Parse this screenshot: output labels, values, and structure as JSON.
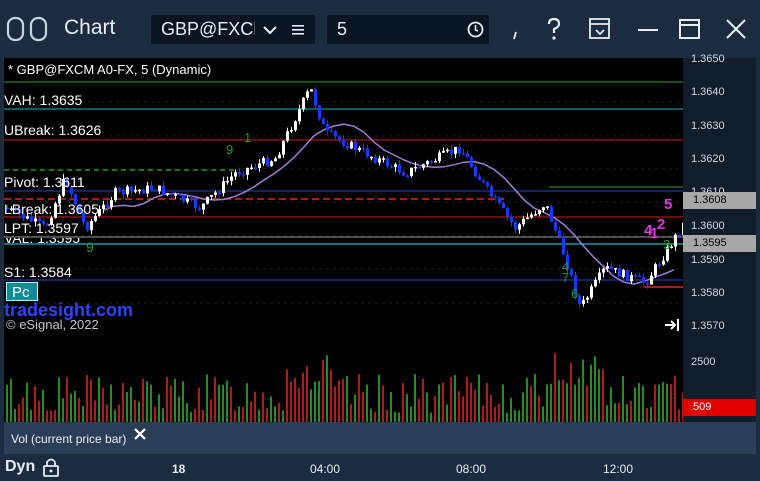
{
  "window": {
    "title": "Chart",
    "symbol_value": "GBP@FXCM",
    "interval_value": "5"
  },
  "chart": {
    "header": "* GBP@FXCM A0-FX, 5 (Dynamic)",
    "level_labels": {
      "vah": "VAH: 1.3635",
      "ubreak": "UBreak: 1.3626",
      "pivot": "Pivot: 1.3611",
      "lbreak": "LBreak: 1.3605",
      "lpt": "LPT: 1.3597",
      "val": "VAL: 1.3595",
      "s1": "S1: 1.3584"
    },
    "partial_badge": "Pc",
    "watermark": "tradesight.com",
    "copyright": "© eSignal, 2022",
    "price_ticks": [
      "1.3650",
      "1.3640",
      "1.3630",
      "1.3620",
      "1.3610",
      "1.3600",
      "1.3590",
      "1.3580",
      "1.3570"
    ],
    "current_price": "1.3608",
    "val_price": "1.3595",
    "counts": [
      "9",
      "4",
      "5",
      "1",
      "2",
      "3",
      "4",
      "7",
      "6",
      "1",
      "9"
    ],
    "colors": {
      "up": "#ffffff",
      "down": "#1638ff",
      "average": "#a07cd8",
      "resistance": "#d21a1a",
      "support_cyan": "#18b5c8",
      "green": "#22a022"
    }
  },
  "volume": {
    "tick": "2500",
    "current_volume": "509",
    "indicator_label": "Vol (current price bar)"
  },
  "xaxis": {
    "labels": [
      "18",
      "04:00",
      "08:00",
      "12:00"
    ],
    "mode_label": "Dyn"
  }
}
